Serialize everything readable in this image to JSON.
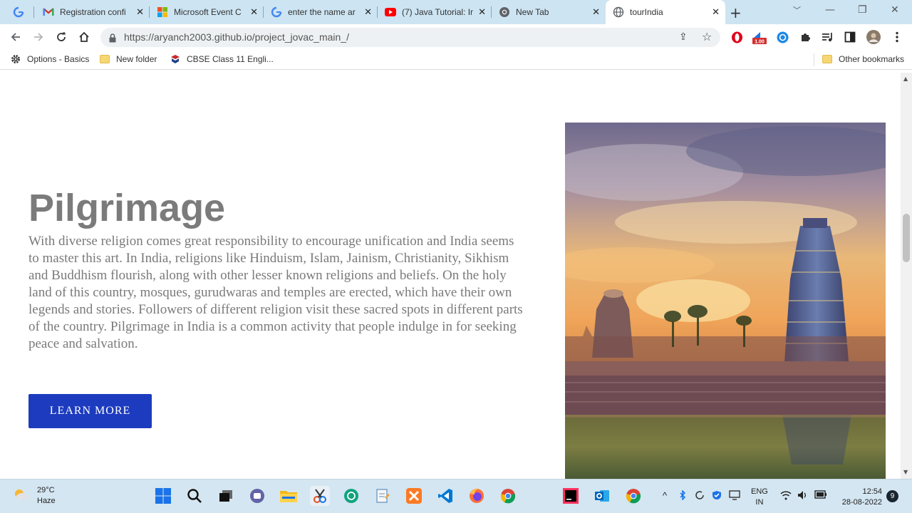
{
  "browser": {
    "tabs": [
      {
        "title": "",
        "icon": "google-icon",
        "active": false
      },
      {
        "title": "Registration confi",
        "icon": "gmail-icon",
        "active": false
      },
      {
        "title": "Microsoft Event C",
        "icon": "microsoft-icon",
        "active": false
      },
      {
        "title": "enter the name ar",
        "icon": "google-icon",
        "active": false
      },
      {
        "title": "(7) Java Tutorial: Ir",
        "icon": "youtube-icon",
        "active": false
      },
      {
        "title": "New Tab",
        "icon": "chrome-icon",
        "active": false
      },
      {
        "title": "tourIndia",
        "icon": "globe-icon",
        "active": true
      }
    ],
    "url": "https://aryanch2003.github.io/project_jovac_main_/",
    "extensions": [
      {
        "icon": "opera-icon"
      },
      {
        "icon": "speed-extension-icon",
        "badge": "1.00"
      },
      {
        "icon": "blue-extension-icon"
      },
      {
        "icon": "puzzle-icon"
      },
      {
        "icon": "playlist-icon"
      },
      {
        "icon": "side-panel-icon"
      },
      {
        "icon": "profile-avatar-icon"
      },
      {
        "icon": "menu-dots-icon"
      }
    ],
    "bookmarks": [
      {
        "label": "Options - Basics",
        "icon": "gear-icon"
      },
      {
        "label": "New folder",
        "icon": "folder-icon"
      },
      {
        "label": "CBSE Class 11 Engli...",
        "icon": "book-icon"
      }
    ],
    "other_bookmarks": "Other bookmarks"
  },
  "page": {
    "heading": "Pilgrimage",
    "description": "With diverse religion comes great responsibility to encourage unification and India seems to master this art. In India, religions like Hinduism, Islam, Jainism, Christianity, Sikhism and Buddhism flourish, along with other lesser known religions and beliefs. On the holy land of this country, mosques, gurudwaras and temples are erected, which have their own legends and stories. Followers of different religion visit these sacred spots in different parts of the country. Pilgrimage in India is a common activity that people indulge in for seeking peace and salvation.",
    "cta_label": "LEARN MORE",
    "image_alt": "temple-photo",
    "accent_color": "#1c3bbf"
  },
  "taskbar": {
    "weather_temp": "29°C",
    "weather_desc": "Haze",
    "apps": [
      "start-icon",
      "search-icon",
      "task-view-icon",
      "teams-chat-icon",
      "file-explorer-icon",
      "snipping-tool-icon",
      "chatgpt-icon",
      "notepad-icon",
      "xampp-icon",
      "vscode-icon",
      "firefox-icon",
      "chrome-icon",
      "intellij-icon",
      "outlook-icon",
      "chrome-profile-icon"
    ],
    "lang_line1": "ENG",
    "lang_line2": "IN",
    "time": "12:54",
    "date": "28-08-2022",
    "notifications": "9"
  }
}
